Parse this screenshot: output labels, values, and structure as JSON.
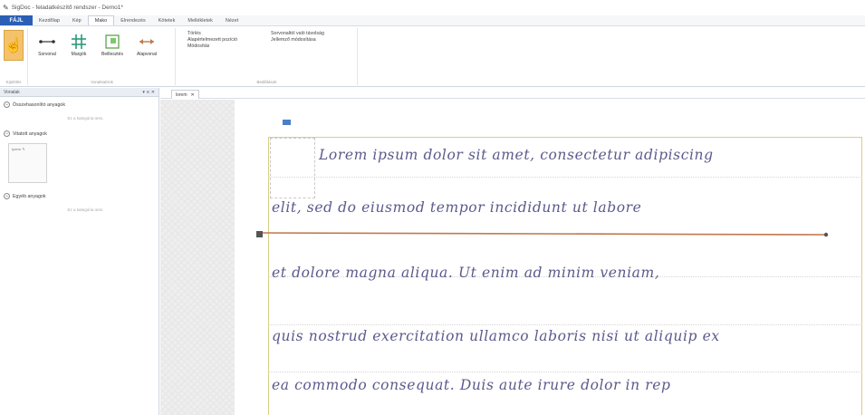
{
  "window": {
    "title": "SigDoc - feladatkészítő rendszer - Demo1*"
  },
  "menu": {
    "file_label": "FÁJL",
    "tabs": [
      "Kezdőlap",
      "Kép",
      "Mako",
      "Elrendezés",
      "Kötetek",
      "Mellékletek",
      "Nézet"
    ],
    "active_tab": "Mako"
  },
  "ribbon": {
    "select_label": "Kijelölés",
    "line_tools": [
      "Sorvonal",
      "Margók",
      "Beillesztés",
      "Alapvonal"
    ],
    "group_lines": "Vonalsatírok",
    "options_col1": [
      "Törlés",
      "Alapértelmezett pozíció",
      "Módosítás"
    ],
    "options_col2": [
      "Sorvonaltól való távolság",
      "Jellemző módosítása"
    ],
    "group_settings": "Beállítások",
    "group_select": "Kijelölés"
  },
  "nav": {
    "header": "Vonalak",
    "header_controls": "▾ ⨯ ✕",
    "sections": [
      {
        "title": "Összehasonlító anyagok",
        "empty_text": "Ez a kategória üres."
      },
      {
        "title": "Vitatott anyagok",
        "thumb_label": "Iperm"
      },
      {
        "title": "Egyéb anyagok",
        "empty_text": "Ez a kategória üres."
      }
    ]
  },
  "doc_tab": {
    "label": "lorem",
    "close": "✕"
  },
  "handwriting": [
    "Lorem ipsum dolor sit amet, consectetur adipiscing",
    "elit, sed do eiusmod tempor incididunt ut labore",
    "et dolore magna aliqua. Ut enim ad minim veniam,",
    "quis nostrud exercitation ullamco laboris nisi ut aliquip ex",
    "ea commodo consequat. Duis aute irure dolor in rep"
  ],
  "colors": {
    "accent": "#2b5fb4",
    "baseline": "#c0794d",
    "frame": "#d9cf84",
    "ink": "#5a5a8c"
  }
}
